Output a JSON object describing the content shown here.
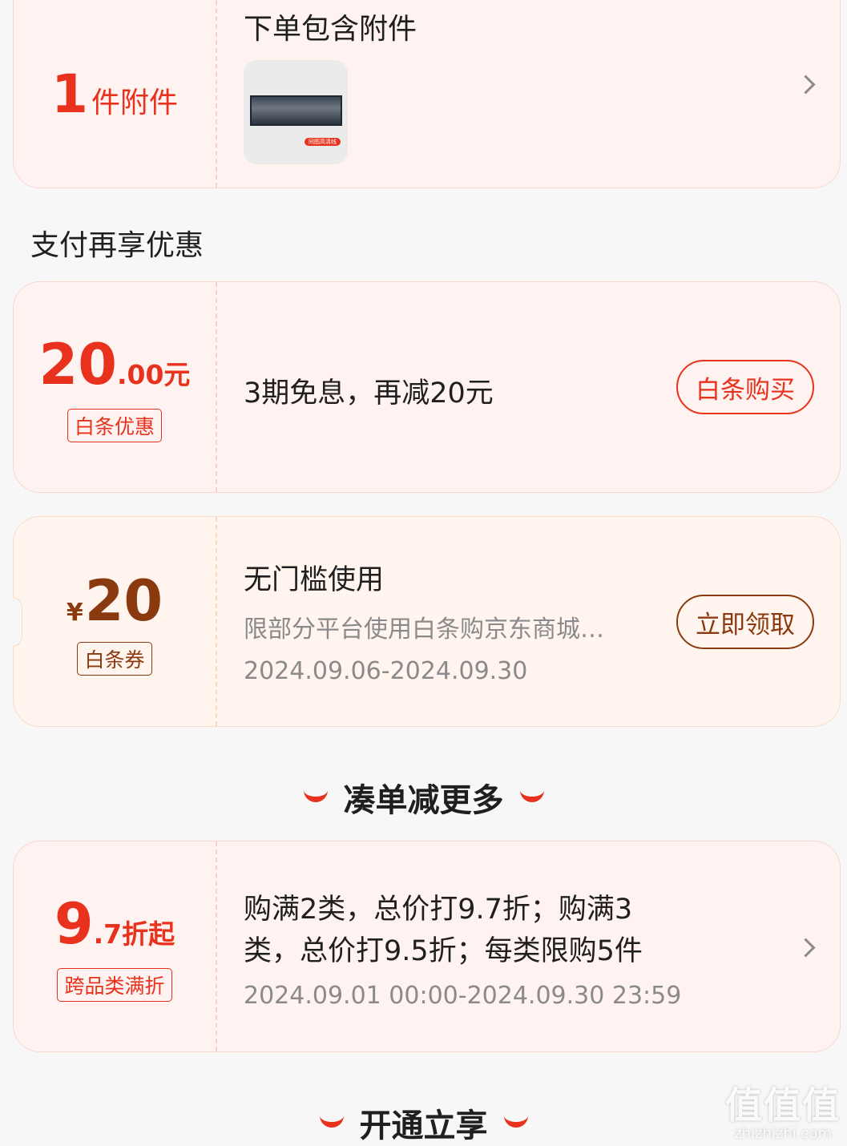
{
  "accessory_card": {
    "count": "1",
    "count_unit": "件附件",
    "title": "下单包含附件",
    "thumb_badge": "同图高清线"
  },
  "pay_section": {
    "title": "支付再享优惠"
  },
  "baitiao_discount": {
    "amount_int": "20",
    "amount_dec": ".00元",
    "tag": "白条优惠",
    "desc": "3期免息，再减20元",
    "button": "白条购买"
  },
  "baitiao_coupon": {
    "currency": "¥",
    "amount": "20",
    "tag": "白条券",
    "title": "无门槛使用",
    "subtitle": "限部分平台使用白条购京东商城…",
    "date_range": "2024.09.06-2024.09.30",
    "button": "立即领取"
  },
  "bundle_section": {
    "title": "凑单减更多"
  },
  "discount_promo": {
    "amount_int": "9",
    "amount_rest": ".7折起",
    "tag": "跨品类满折",
    "line1": "购满2类，总价打9.7折；购满3",
    "line2": "类，总价打9.5折；每类限购5件",
    "date_range": "2024.09.01 00:00-2024.09.30 23:59"
  },
  "open_section": {
    "title": "开通立享"
  },
  "watermark": {
    "logo": "值值值",
    "site": "zhizhizhi.com"
  },
  "colors": {
    "accent_red": "#e8321d",
    "coupon_brown": "#8b3a0f",
    "gray_text": "#8a8a8a"
  }
}
